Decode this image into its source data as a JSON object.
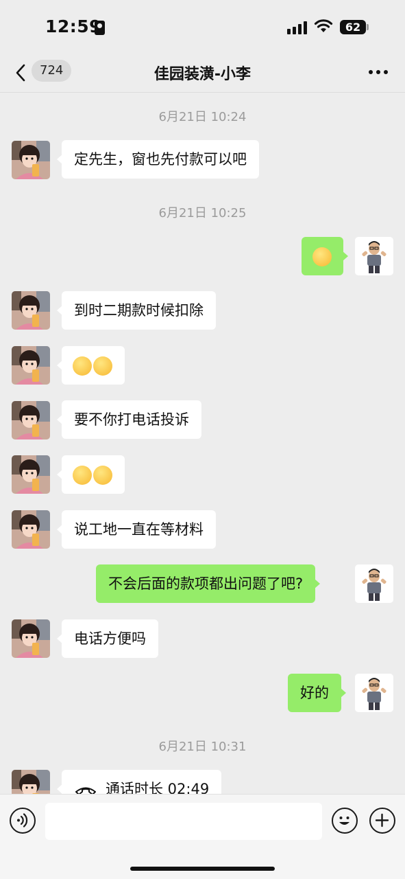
{
  "status_bar": {
    "time": "12:59",
    "battery": "62",
    "icons": [
      "portrait-lock-icon",
      "signal-icon",
      "wifi-icon",
      "battery-icon"
    ]
  },
  "header": {
    "back_icon": "chevron-left-icon",
    "unread_count": "724",
    "title": "佳园装潢-小李",
    "more_icon": "more-dots-icon"
  },
  "messages": {
    "ts1": "6月21日 10:24",
    "m1": "定先生，窗也先付款可以吧",
    "ts2": "6月21日 10:25",
    "m2_emoji": "persevering-face-emoji",
    "m3": "到时二期款时候扣除",
    "m4_emoji": "rolling-on-floor-laughing-emoji x2",
    "m5": "要不你打电话投诉",
    "m6_emoji": "shushing-face-emoji x2",
    "m7": "说工地一直在等材料",
    "m8": "不会后面的款项都出问题了吧?",
    "m9": "电话方便吗",
    "m10": "好的",
    "ts3": "6月21日 10:31",
    "m11": "通话时长 02:49"
  },
  "input_bar": {
    "voice_icon": "voice-icon",
    "emoji_icon": "emoji-icon",
    "plus_icon": "plus-icon",
    "input_value": ""
  },
  "colors": {
    "background": "#ededed",
    "incoming_bubble": "#ffffff",
    "outgoing_bubble": "#95ec69",
    "timestamp": "#9b9b9b"
  }
}
